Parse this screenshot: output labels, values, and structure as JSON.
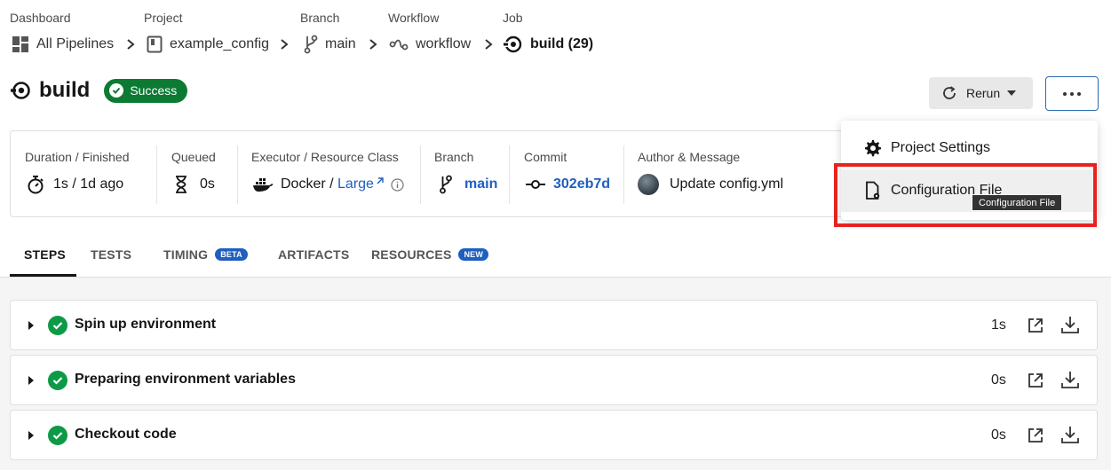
{
  "breadcrumb": {
    "labels": [
      "Dashboard",
      "Project",
      "Branch",
      "Workflow",
      "Job"
    ],
    "items": [
      "All Pipelines",
      "example_config",
      "main",
      "workflow",
      "build (29)"
    ]
  },
  "job": {
    "title": "build",
    "status": "Success",
    "rerun_label": "Rerun"
  },
  "info": {
    "duration": {
      "label": "Duration / Finished",
      "value": "1s / 1d ago"
    },
    "queued": {
      "label": "Queued",
      "value": "0s"
    },
    "executor": {
      "label": "Executor / Resource Class",
      "executor": "Docker",
      "separator": " / ",
      "resource_class": "Large"
    },
    "branch": {
      "label": "Branch",
      "value": "main"
    },
    "commit": {
      "label": "Commit",
      "value": "302eb7d"
    },
    "author": {
      "label": "Author & Message",
      "message": "Update config.yml"
    }
  },
  "tabs": [
    {
      "label": "STEPS",
      "active": true
    },
    {
      "label": "TESTS"
    },
    {
      "label": "TIMING",
      "badge": "BETA"
    },
    {
      "label": "ARTIFACTS"
    },
    {
      "label": "RESOURCES",
      "badge": "NEW"
    }
  ],
  "steps": [
    {
      "name": "Spin up environment",
      "duration": "1s"
    },
    {
      "name": "Preparing environment variables",
      "duration": "0s"
    },
    {
      "name": "Checkout code",
      "duration": "0s"
    }
  ],
  "menu": {
    "items": [
      "Project Settings",
      "Configuration File"
    ],
    "tooltip": "Configuration File"
  },
  "colors": {
    "success": "#0d7a33",
    "link": "#1f5fbf",
    "highlight": "#e8231f"
  }
}
